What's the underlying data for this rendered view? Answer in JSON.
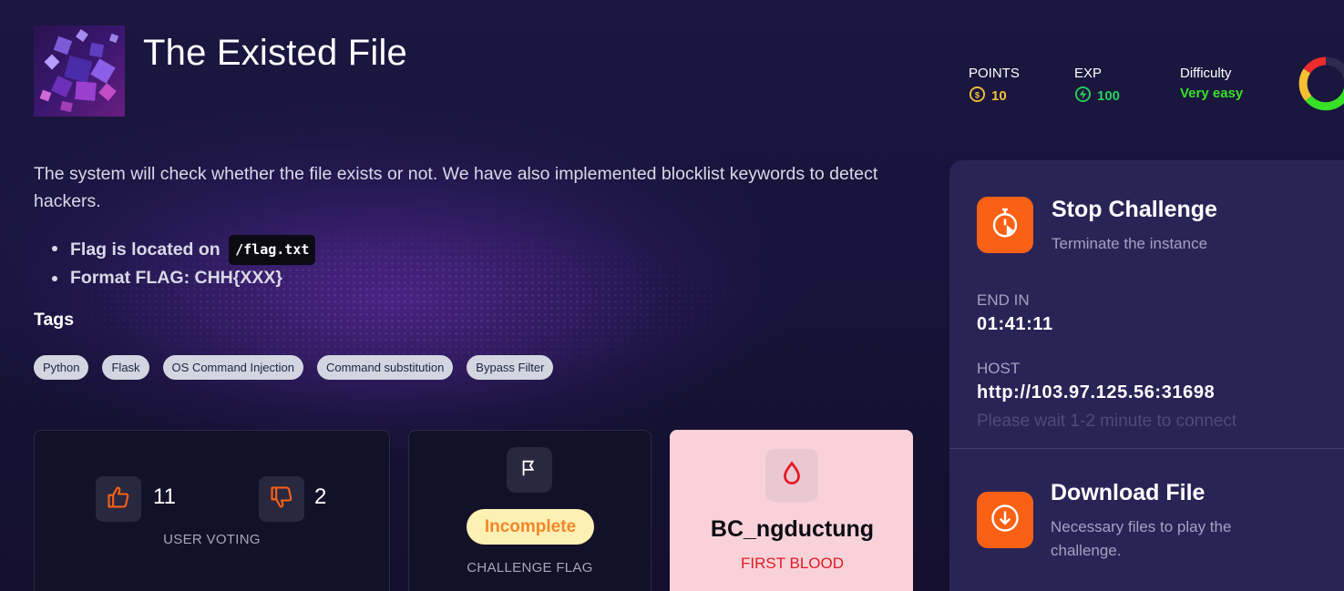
{
  "challenge": {
    "title": "The Existed File",
    "description": "The system will check whether the file exists or not. We have also implemented blocklist keywords to detect hackers.",
    "bullets": [
      {
        "text": "Flag is located on",
        "code": "/flag.txt"
      },
      {
        "text": "Format FLAG: CHH{XXX}"
      }
    ]
  },
  "stats": {
    "points_label": "POINTS",
    "points_value": "10",
    "exp_label": "EXP",
    "exp_value": "100",
    "difficulty_label": "Difficulty",
    "difficulty_value": "Very easy"
  },
  "tags": {
    "heading": "Tags",
    "items": [
      "Python",
      "Flask",
      "OS Command Injection",
      "Command substitution",
      "Bypass Filter"
    ]
  },
  "voting": {
    "likes": "11",
    "dislikes": "2",
    "label": "USER VOTING"
  },
  "flag": {
    "status": "Incomplete",
    "label": "CHALLENGE FLAG"
  },
  "first_blood": {
    "user": "BC_ngductung",
    "label": "FIRST BLOOD"
  },
  "instance": {
    "stop_title": "Stop Challenge",
    "stop_sub": "Terminate the instance",
    "end_label": "END IN",
    "end_value": "01:41:11",
    "host_label": "HOST",
    "host_value": "http://103.97.125.56:31698",
    "host_note": "Please wait 1-2 minute to connect",
    "download_title": "Download File",
    "download_sub": "Necessary files to play the challenge."
  },
  "colors": {
    "accent_orange": "#fb6115",
    "points_yellow": "#f3c034",
    "exp_green": "#25d05a",
    "difficulty_green": "#39e028",
    "panel_bg": "#2a2456",
    "blood_red": "#e21a25"
  },
  "icons": {
    "points": "coin-icon",
    "exp": "lightning-icon",
    "like": "thumbs-up-icon",
    "dislike": "thumbs-down-icon",
    "flag": "flag-icon",
    "blood": "blood-drop-icon",
    "stop": "stopwatch-icon",
    "download": "download-icon"
  }
}
